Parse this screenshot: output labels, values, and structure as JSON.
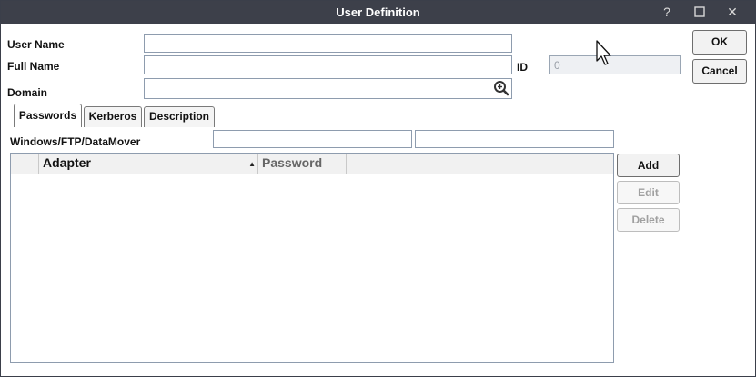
{
  "window": {
    "title": "User Definition",
    "help_glyph": "?",
    "maximize_glyph": "☐",
    "close_glyph": "✕"
  },
  "form": {
    "user_name_label": "User Name",
    "user_name_value": "",
    "full_name_label": "Full Name",
    "full_name_value": "",
    "domain_label": "Domain",
    "domain_value": "",
    "id_label": "ID",
    "id_value": "0"
  },
  "dialog_buttons": {
    "ok": "OK",
    "cancel": "Cancel"
  },
  "tabs": [
    {
      "label": "Passwords",
      "active": true
    },
    {
      "label": "Kerberos",
      "active": false
    },
    {
      "label": "Description",
      "active": false
    }
  ],
  "passwords": {
    "windows_label": "Windows/FTP/DataMover",
    "password_value": "",
    "confirm_value": "",
    "table": {
      "columns": [
        "Adapter",
        "Password"
      ],
      "sort_indicator": "▲",
      "rows": []
    },
    "buttons": {
      "add": "Add",
      "edit": "Edit",
      "delete": "Delete"
    }
  },
  "colors": {
    "titlebar": "#3d404a",
    "field_border": "#8e9cae",
    "disabled_text": "#a0a0a0"
  }
}
